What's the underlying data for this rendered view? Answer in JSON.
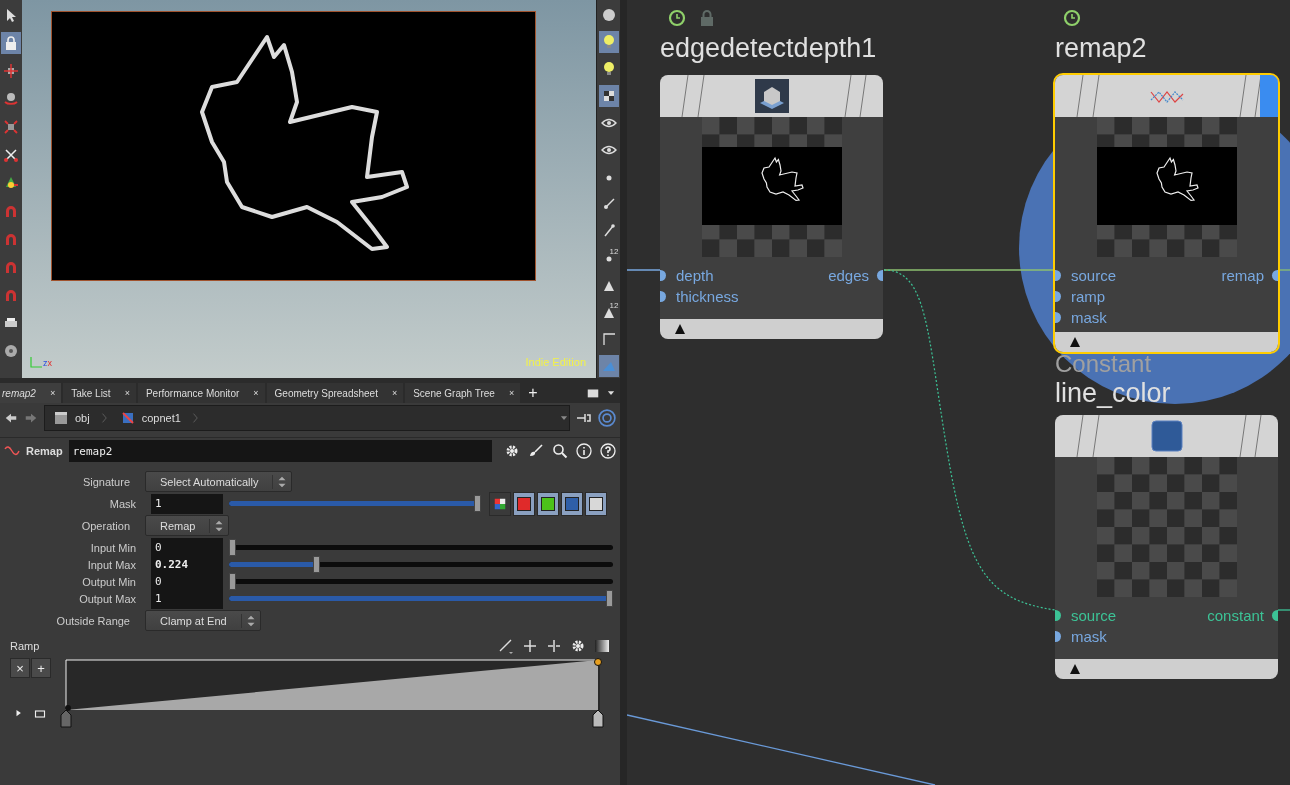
{
  "viewport": {
    "edition_label": "Indie Edition",
    "axis_labels": [
      "z",
      "x"
    ]
  },
  "left_toolbar": [
    {
      "kind": "pointer",
      "selected": false
    },
    {
      "kind": "lock",
      "selected": true
    },
    {
      "kind": "move",
      "selected": false
    },
    {
      "kind": "rotate",
      "selected": false
    },
    {
      "kind": "scale",
      "selected": false
    },
    {
      "kind": "handle",
      "selected": false
    },
    {
      "kind": "pose",
      "selected": false
    },
    {
      "kind": "magnet",
      "selected": false
    },
    {
      "kind": "magnet",
      "selected": false
    },
    {
      "kind": "magnet",
      "selected": false
    },
    {
      "kind": "magnet",
      "selected": false
    },
    {
      "kind": "render",
      "selected": false
    },
    {
      "kind": "reel",
      "selected": false
    }
  ],
  "right_toolbar": [
    {
      "kind": "sphere",
      "selected": false
    },
    {
      "kind": "light",
      "selected": true
    },
    {
      "kind": "light",
      "selected": false
    },
    {
      "kind": "cube",
      "selected": true
    },
    {
      "kind": "eye",
      "selected": false
    },
    {
      "kind": "eye",
      "selected": false
    },
    {
      "kind": "dot",
      "selected": false
    },
    {
      "kind": "brush",
      "selected": false
    },
    {
      "kind": "pin",
      "selected": false
    },
    {
      "kind": "dot",
      "selected": false,
      "badge": "12"
    },
    {
      "kind": "bevel",
      "selected": false
    },
    {
      "kind": "bevel",
      "selected": false,
      "badge": "12"
    },
    {
      "kind": "curve",
      "selected": false
    },
    {
      "kind": "pen",
      "selected": true
    }
  ],
  "tabs": [
    {
      "label": "remap2",
      "close": "×",
      "selected": true
    },
    {
      "label": "Take List",
      "close": "×",
      "selected": false
    },
    {
      "label": "Performance Monitor",
      "close": "×",
      "selected": false
    },
    {
      "label": "Geometry Spreadsheet",
      "close": "×",
      "selected": false
    },
    {
      "label": "Scene Graph Tree",
      "close": "×",
      "selected": false
    }
  ],
  "add_tab": "+",
  "path": [
    "obj",
    "copnet1"
  ],
  "parameters": {
    "node_type": "Remap",
    "node_name": "remap2",
    "rows": [
      {
        "kind": "menu",
        "label": "Signature",
        "value": "Select Automatically"
      },
      {
        "kind": "slider",
        "label": "Mask",
        "value": "1",
        "level": 1,
        "modified": false,
        "channels": [
          {
            "color": "#e02a2a",
            "on": true
          },
          {
            "color": "#4cc21a",
            "on": true
          },
          {
            "color": "#2f5fa8",
            "on": true
          },
          {
            "color": "#d8d8d8",
            "on": true
          }
        ]
      },
      {
        "kind": "menu",
        "label": "Operation",
        "value": "Remap"
      },
      {
        "kind": "slider",
        "label": "Input Min",
        "value": "0",
        "level": 0,
        "modified": false
      },
      {
        "kind": "slider",
        "label": "Input Max",
        "value": "0.224",
        "level": 0.224,
        "modified": true
      },
      {
        "kind": "slider",
        "label": "Output Min",
        "value": "0",
        "level": 0,
        "modified": false
      },
      {
        "kind": "slider",
        "label": "Output Max",
        "value": "1",
        "level": 1,
        "modified": false
      },
      {
        "kind": "menu",
        "label": "Outside Range",
        "value": "Clamp at End"
      }
    ],
    "ramp": {
      "label": "Ramp",
      "remove": "×",
      "add": "+"
    }
  },
  "nodes": [
    {
      "title": "edgedetectdepth1",
      "kind": "edge",
      "selected": false,
      "time_dependent": true,
      "locked": true,
      "display": false,
      "inputs": [
        {
          "name": "depth",
          "color": "#78a8e0"
        },
        {
          "name": "thickness",
          "color": "#78a8e0"
        }
      ],
      "outputs": [
        {
          "name": "edges",
          "color": "#78a8e0"
        }
      ]
    },
    {
      "title": "remap2",
      "kind": "remap",
      "selected": true,
      "time_dependent": true,
      "locked": false,
      "display": true,
      "inputs": [
        {
          "name": "source",
          "color": "#78a8e0"
        },
        {
          "name": "ramp",
          "color": "#78a8e0"
        },
        {
          "name": "mask",
          "color": "#78a8e0"
        }
      ],
      "outputs": [
        {
          "name": "remap",
          "color": "#78a8e0"
        }
      ]
    },
    {
      "title": "line_color",
      "type_label": "Constant",
      "kind": "constant",
      "selected": false,
      "time_dependent": false,
      "locked": false,
      "display": false,
      "inputs": [
        {
          "name": "source",
          "color": "#3cc396"
        },
        {
          "name": "mask",
          "color": "#78a8e0"
        }
      ],
      "outputs": [
        {
          "name": "constant",
          "color": "#3cc396"
        }
      ]
    }
  ]
}
